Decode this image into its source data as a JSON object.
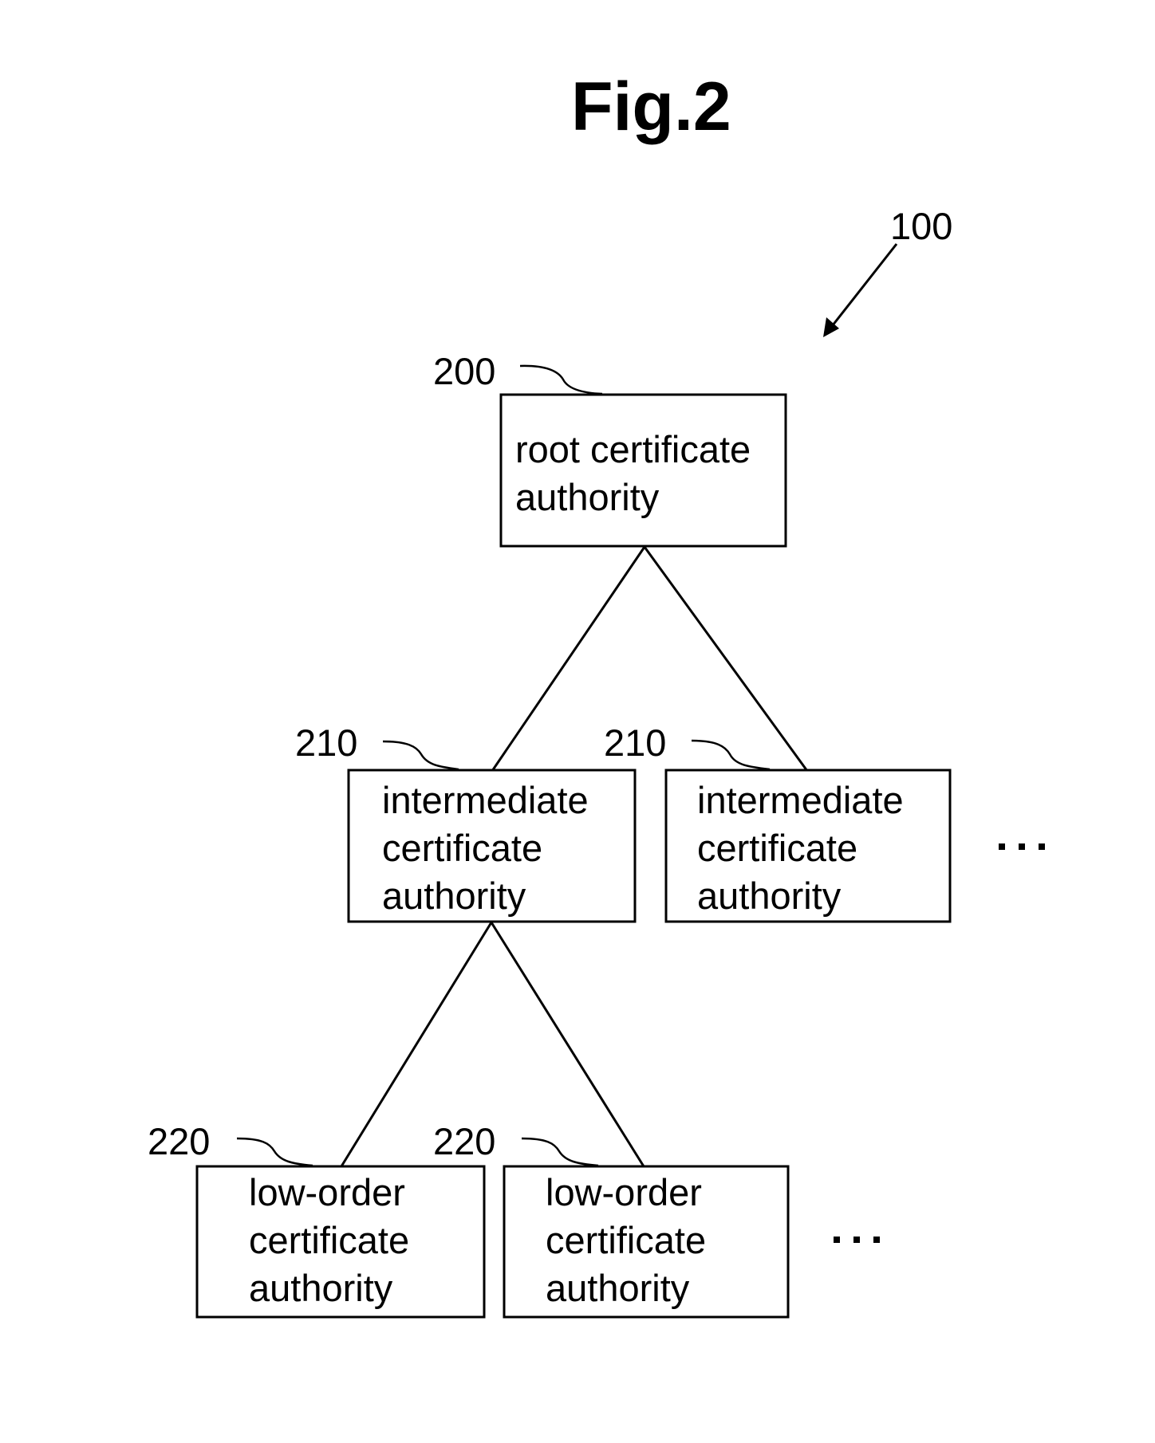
{
  "figure": {
    "title": "Fig.2",
    "system_ref": "100",
    "colors": {
      "ink": "#000000",
      "background": "#ffffff"
    }
  },
  "nodes": {
    "root": {
      "ref": "200",
      "lines": [
        "root certificate",
        "authority"
      ]
    },
    "intermediate_1": {
      "ref": "210",
      "lines": [
        "intermediate",
        "certificate",
        "authority"
      ]
    },
    "intermediate_2": {
      "ref": "210",
      "lines": [
        "intermediate",
        "certificate",
        "authority"
      ]
    },
    "low_order_1": {
      "ref": "220",
      "lines": [
        "low-order",
        "certificate",
        "authority"
      ]
    },
    "low_order_2": {
      "ref": "220",
      "lines": [
        "low-order",
        "certificate",
        "authority"
      ]
    }
  },
  "continuation": {
    "intermediate_more": "· · ·",
    "low_order_more": "· · ·"
  },
  "edges": [
    {
      "from": "root",
      "to": "intermediate_1"
    },
    {
      "from": "root",
      "to": "intermediate_2"
    },
    {
      "from": "intermediate_1",
      "to": "low_order_1"
    },
    {
      "from": "intermediate_1",
      "to": "low_order_2"
    }
  ]
}
